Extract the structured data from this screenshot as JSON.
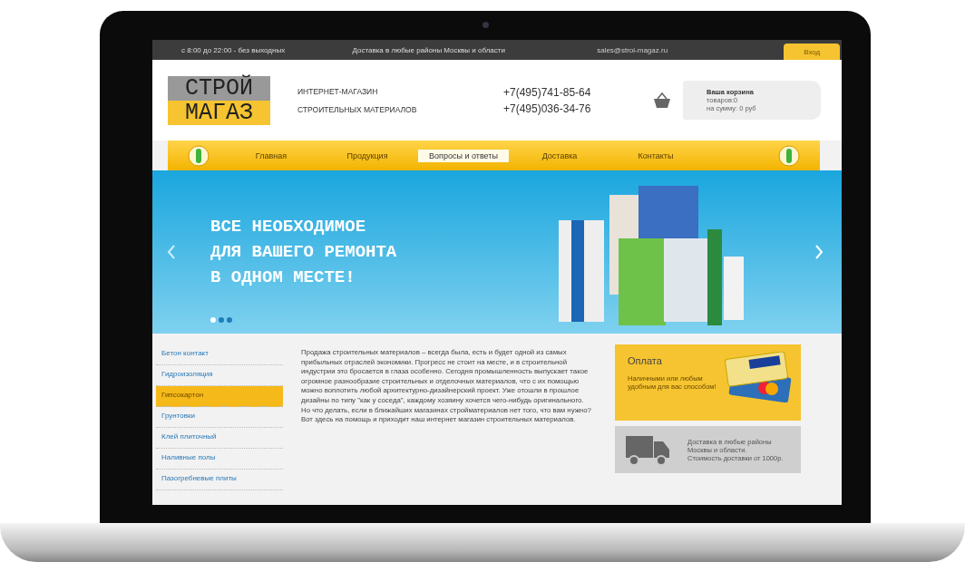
{
  "top_bar": {
    "hours": "с 8:00 до 22:00 - без выходных",
    "delivery": "Доставка в любые районы Москвы и области",
    "email": "sales@stroi-magaz.ru",
    "login": "Вход"
  },
  "header": {
    "logo": [
      "СТРОЙ",
      "МАГАЗ"
    ],
    "tagline": [
      "ИНТЕРНЕТ-МАГАЗИН",
      "СТРОИТЕЛЬНЫХ МАТЕРИАЛОВ"
    ],
    "phones": [
      "+7(495)741-85-64",
      "+7(495)036-34-76"
    ],
    "cart": {
      "title": "Ваша корзина",
      "items": "товаров:0",
      "sum": "на сумму: 0 руб"
    }
  },
  "nav": [
    {
      "label": "Главная",
      "selected": false
    },
    {
      "label": "Продукция",
      "selected": false
    },
    {
      "label": "Вопросы и ответы",
      "selected": true
    },
    {
      "label": "Доставка",
      "selected": false
    },
    {
      "label": "Контакты",
      "selected": false
    }
  ],
  "banner": {
    "lines": [
      "ВСЕ НЕОБХОДИМОЕ",
      "ДЛЯ ВАШЕГО РЕМОНТА",
      "В ОДНОМ МЕСТЕ!"
    ],
    "dots": [
      {
        "selected": true
      },
      {
        "selected": false
      },
      {
        "selected": false
      }
    ]
  },
  "sidebar": [
    {
      "label": "Бетон контакт",
      "selected": false
    },
    {
      "label": "Гидроизоляция",
      "selected": false
    },
    {
      "label": "Гипсокартон",
      "selected": true
    },
    {
      "label": "Грунтовки",
      "selected": false
    },
    {
      "label": "Клей плиточный",
      "selected": false
    },
    {
      "label": "Наливные полы",
      "selected": false
    },
    {
      "label": "Пазогребневые плиты",
      "selected": false
    }
  ],
  "article": "Продажа строительных материалов – всегда была, есть и будет одной из самых прибыльных отраслей экономики. Прогресс не стоит на месте, и в строительной индустрии это бросается в глаза особенно. Сегодня промышленность выпускает такое огромное разнообразие строительных и отделочных материалов, что с их помощью можно воплотить любой архитектурно-дизайнерский проект. Уже отошли в прошлое дизайны по типу \"как у соседа\", каждому хозяину хочется чего-нибудь оригинального. Но что делать, если в ближайших магазинах стройматериалов нет того, что вам нужно? Вот здесь на помощь и приходит наш интернет магазин строительных материалов.",
  "payment": {
    "title": "Оплата",
    "text": "Наличными или любым удобным для вас способом!"
  },
  "delivery": {
    "lines": [
      "Доставка в любые районы",
      "Москвы и области.",
      "Стоимость доставки от 1000р."
    ]
  }
}
